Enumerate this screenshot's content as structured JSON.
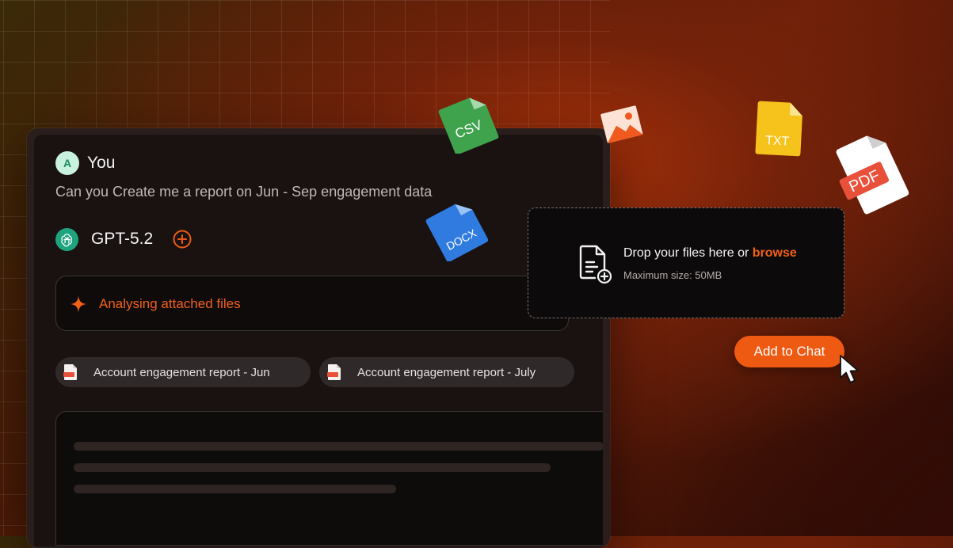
{
  "conversation": {
    "user": {
      "avatar_initial": "A",
      "name": "You",
      "message": "Can you Create me a report on Jun - Sep engagement data"
    },
    "assistant": {
      "model_name": "GPT-5.2",
      "status_text": "Analysing attached files"
    },
    "attachments": [
      {
        "label": "Account engagement report - Jun",
        "icon": "pdf-file-icon"
      },
      {
        "label": "Account engagement report - July",
        "icon": "pdf-file-icon"
      }
    ]
  },
  "dropzone": {
    "prompt": "Drop your files here or",
    "browse_label": "browse",
    "max_size": "Maximum size: 50MB"
  },
  "add_to_chat_label": "Add to Chat",
  "floating_files": {
    "csv": "CSV",
    "docx": "DOCX",
    "txt": "TXT",
    "pdf": "PDF"
  },
  "colors": {
    "accent": "#ee5a12",
    "status_text": "#f2611a",
    "csv": "#3fa34d",
    "docx": "#2f7be0",
    "txt": "#f6c21c",
    "pdf": "#e8503a",
    "image": "#f05a1e"
  }
}
